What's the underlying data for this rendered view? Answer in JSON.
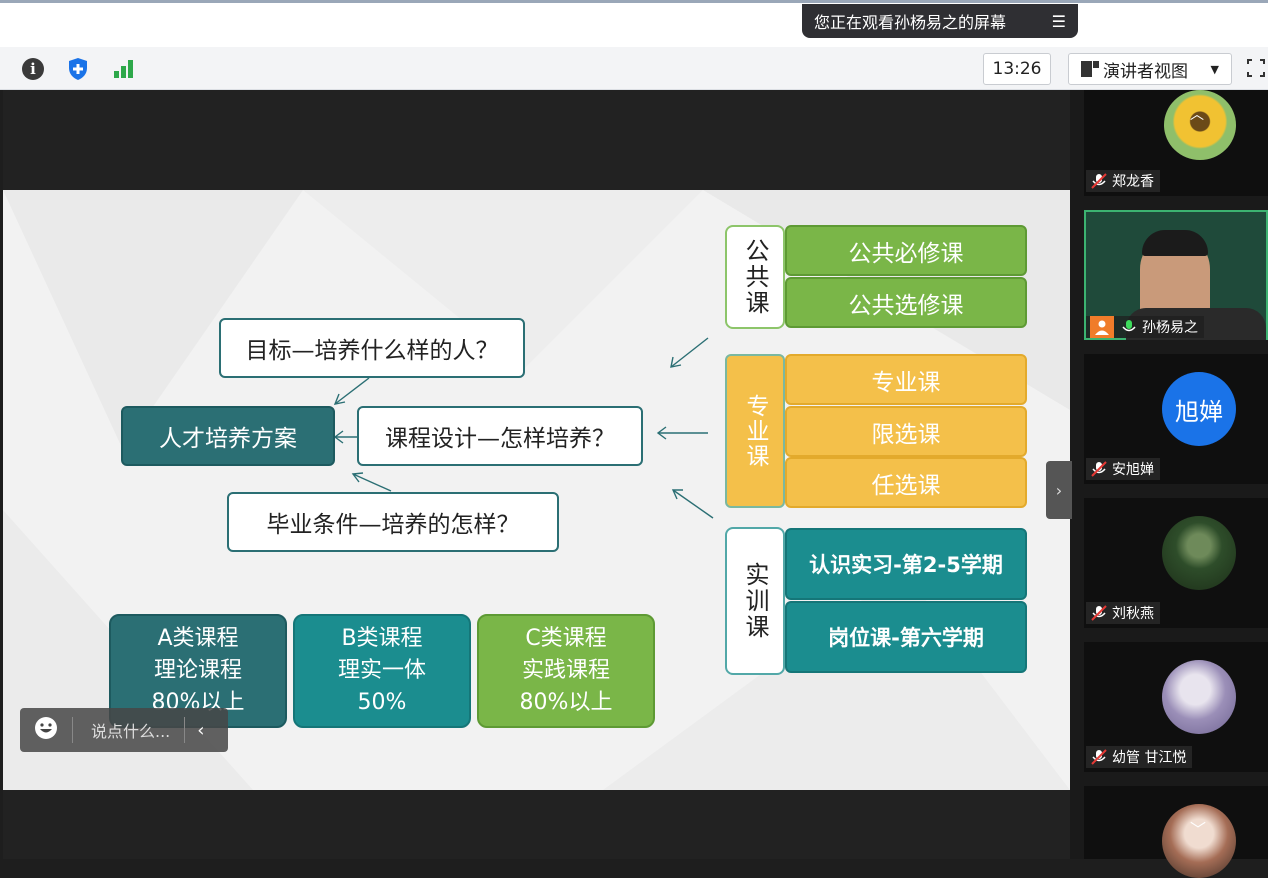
{
  "banner": {
    "text": "您正在观看孙杨易之的屏幕",
    "menu_glyph": "☰"
  },
  "toolbar": {
    "time": "13:26",
    "view_label": "演讲者视图"
  },
  "slide": {
    "target_q": "目标—培养什么样的人？",
    "center": "人才培养方案",
    "design_q": "课程设计—怎样培养？",
    "grad_q": "毕业条件—培养的怎样？",
    "public_vert": "公共课",
    "public_items": [
      "公共必修课",
      "公共选修课"
    ],
    "major_vert": "专业课",
    "major_items": [
      "专业课",
      "限选课",
      "任选课"
    ],
    "practice_vert": "实训课",
    "practice_items": [
      "认识实习-第2-5学期",
      "岗位课-第六学期"
    ],
    "categories": [
      {
        "l1": "A类课程",
        "l2": "理论课程",
        "l3": "80%以上"
      },
      {
        "l1": "B类课程",
        "l2": "理实一体",
        "l3": "50%"
      },
      {
        "l1": "C类课程",
        "l2": "实践课程",
        "l3": "80%以上"
      }
    ]
  },
  "chat": {
    "placeholder": "说点什么..."
  },
  "participants": [
    {
      "name": "郑龙香",
      "avatar_text": ""
    },
    {
      "name": "孙杨易之",
      "avatar_text": ""
    },
    {
      "name": "安旭婵",
      "avatar_text": "旭婵"
    },
    {
      "name": "刘秋燕",
      "avatar_text": ""
    },
    {
      "name": "幼管  甘江悦",
      "avatar_text": ""
    }
  ],
  "colors": {
    "accent_blue": "#1a73e8",
    "teal": "#2b6f74",
    "green": "#7ab648",
    "yellow": "#f4c04a"
  }
}
